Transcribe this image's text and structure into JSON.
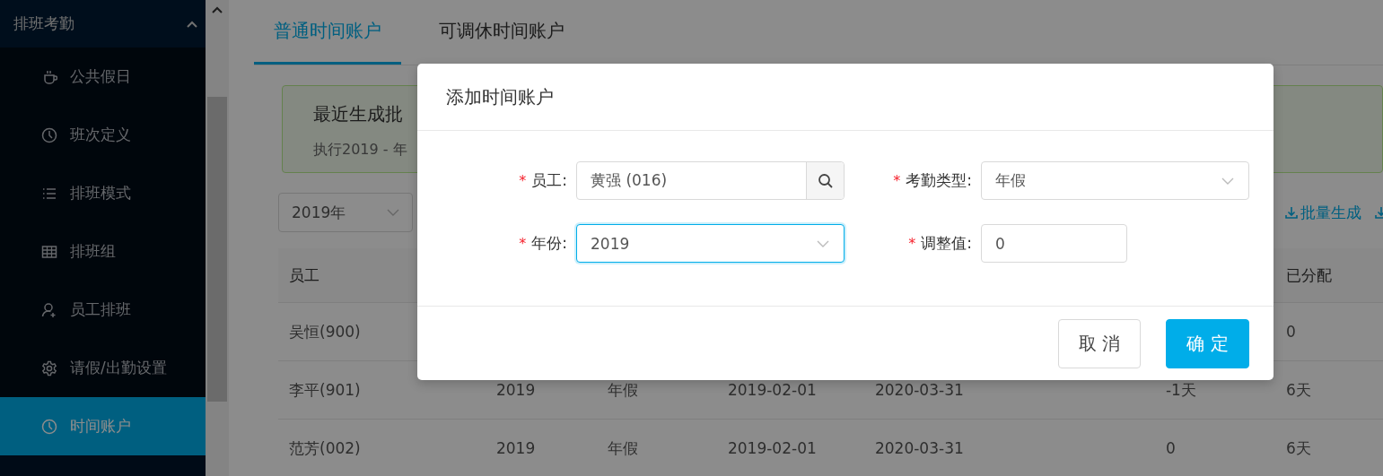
{
  "sidebar": {
    "header": {
      "label": "排班考勤",
      "expanded": true
    },
    "items": [
      {
        "label": "公共假日",
        "selected": false
      },
      {
        "label": "班次定义",
        "selected": false
      },
      {
        "label": "排班模式",
        "selected": false
      },
      {
        "label": "排班组",
        "selected": false
      },
      {
        "label": "员工排班",
        "selected": false
      },
      {
        "label": "请假/出勤设置",
        "selected": false
      },
      {
        "label": "时间账户",
        "selected": true
      }
    ]
  },
  "tabs": [
    {
      "label": "普通时间账户",
      "selected": true
    },
    {
      "label": "可调休时间账户",
      "selected": false
    }
  ],
  "alert": {
    "title": "最近生成批",
    "text": "执行2019 - 年"
  },
  "filter": {
    "value": "2019年"
  },
  "actions": [
    {
      "label": "批量生成"
    }
  ],
  "table": {
    "columns": [
      {
        "label": "员工"
      },
      {
        "label": "已分配"
      }
    ],
    "rows": [
      {
        "employee": "吴恒(900)",
        "allocated": "0"
      },
      {
        "employee": "李平(901)",
        "column_2": "2019",
        "column_3": "年假",
        "column_4": "2019-02-01",
        "column_5": "2020-03-31",
        "column_6": "-1天",
        "allocated": "6天"
      },
      {
        "employee": "范芳(002)",
        "column_2": "2019",
        "column_3": "年假",
        "column_4": "2019-02-01",
        "column_5": "2020-03-31",
        "column_6": "0",
        "allocated": "6天"
      }
    ]
  },
  "dialog": {
    "title": "添加时间账户",
    "fields": [
      {
        "label": "员工:",
        "kind": "search",
        "value": "黄强 (016)",
        "required_mark": "*",
        "focused": false
      },
      {
        "label": "考勤类型:",
        "kind": "select",
        "value": "年假",
        "required_mark": "*",
        "focused": false
      },
      {
        "label": "年份:",
        "kind": "select",
        "value": "2019",
        "required_mark": "*",
        "focused": true
      },
      {
        "label": "调整值:",
        "kind": "input",
        "value": "0",
        "required_mark": "*",
        "focused": false
      }
    ],
    "buttons": [
      {
        "label": "取 消",
        "kind": "default"
      },
      {
        "label": "确 定",
        "kind": "primary"
      }
    ]
  }
}
